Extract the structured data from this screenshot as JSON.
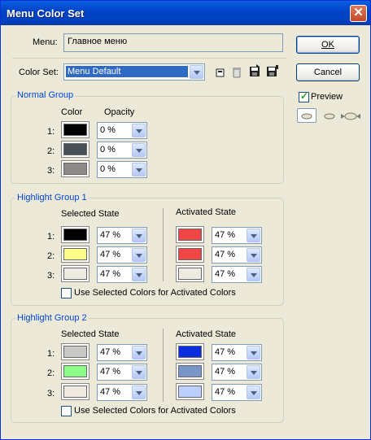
{
  "window": {
    "title": "Menu Color Set",
    "close_glyph": "✕"
  },
  "menu": {
    "label": "Menu:",
    "value": "Главное меню"
  },
  "color_set": {
    "label": "Color Set:",
    "value": "Menu Default"
  },
  "buttons": {
    "ok": "OK",
    "cancel": "Cancel"
  },
  "preview": {
    "label": "Preview",
    "checked": true
  },
  "normal_group": {
    "title": "Normal Group",
    "col_color": "Color",
    "col_opacity": "Opacity",
    "rows": [
      {
        "num": "1:",
        "color": "#000000",
        "opacity": "0 %"
      },
      {
        "num": "2:",
        "color": "#474f57",
        "opacity": "0 %"
      },
      {
        "num": "3:",
        "color": "#8d8984",
        "opacity": "0 %"
      }
    ]
  },
  "highlight_group_1": {
    "title": "Highlight Group 1",
    "selected_header": "Selected State",
    "activated_header": "Activated State",
    "rows": [
      {
        "num": "1:",
        "sel_color": "#000000",
        "sel_opacity": "47 %",
        "act_color": "#f04646",
        "act_opacity": "47 %"
      },
      {
        "num": "2:",
        "sel_color": "#ffff8a",
        "sel_opacity": "47 %",
        "act_color": "#f04646",
        "act_opacity": "47 %"
      },
      {
        "num": "3:",
        "sel_color": "#efebe0",
        "sel_opacity": "47 %",
        "act_color": "#efebe0",
        "act_opacity": "47 %"
      }
    ],
    "use_selected_label": "Use Selected Colors for Activated Colors",
    "use_selected_checked": false
  },
  "highlight_group_2": {
    "title": "Highlight Group 2",
    "selected_header": "Selected State",
    "activated_header": "Activated State",
    "rows": [
      {
        "num": "1:",
        "sel_color": "#cac8c3",
        "sel_opacity": "47 %",
        "act_color": "#0a2ede",
        "act_opacity": "47 %"
      },
      {
        "num": "2:",
        "sel_color": "#8aff8a",
        "sel_opacity": "47 %",
        "act_color": "#7896c8",
        "act_opacity": "47 %"
      },
      {
        "num": "3:",
        "sel_color": "#efebe0",
        "sel_opacity": "47 %",
        "act_color": "#bccfff",
        "act_opacity": "47 %"
      }
    ],
    "use_selected_label": "Use Selected Colors for Activated Colors",
    "use_selected_checked": false
  },
  "icons": [
    "new-set-icon",
    "delete-set-icon",
    "save-set-icon",
    "save-as-set-icon",
    "preview-small-icon",
    "preview-medium-icon",
    "preview-large-icon"
  ]
}
